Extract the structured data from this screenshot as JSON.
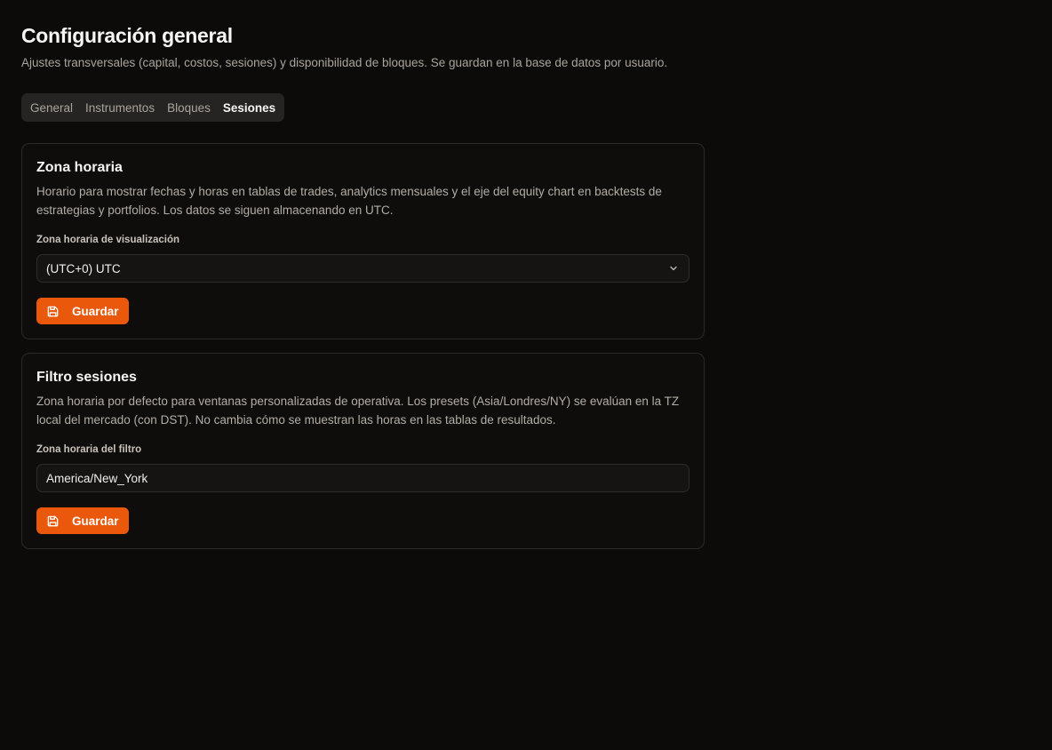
{
  "header": {
    "title": "Configuración general",
    "subtitle": "Ajustes transversales (capital, costos, sesiones) y disponibilidad de bloques. Se guardan en la base de datos por usuario."
  },
  "tabs": [
    {
      "label": "General",
      "active": false
    },
    {
      "label": "Instrumentos",
      "active": false
    },
    {
      "label": "Bloques",
      "active": false
    },
    {
      "label": "Sesiones",
      "active": true
    }
  ],
  "timezone_card": {
    "title": "Zona horaria",
    "description": "Horario para mostrar fechas y horas en tablas de trades, analytics mensuales y el eje del equity chart en backtests de estrategias y portfolios. Los datos se siguen almacenando en UTC.",
    "field_label": "Zona horaria de visualización",
    "selected_value": "(UTC+0) UTC",
    "save_label": "Guardar"
  },
  "sessions_card": {
    "title": "Filtro sesiones",
    "description": "Zona horaria por defecto para ventanas personalizadas de operativa. Los presets (Asia/Londres/NY) se evalúan en la TZ local del mercado (con DST). No cambia cómo se muestran las horas en las tablas de resultados.",
    "field_label": "Zona horaria del filtro",
    "input_value": "America/New_York",
    "save_label": "Guardar"
  },
  "colors": {
    "accent": "#ea580c",
    "background": "#0c0b0a"
  },
  "icons": {
    "save": "floppy-disk-icon",
    "select_chevron": "chevron-down-icon"
  }
}
